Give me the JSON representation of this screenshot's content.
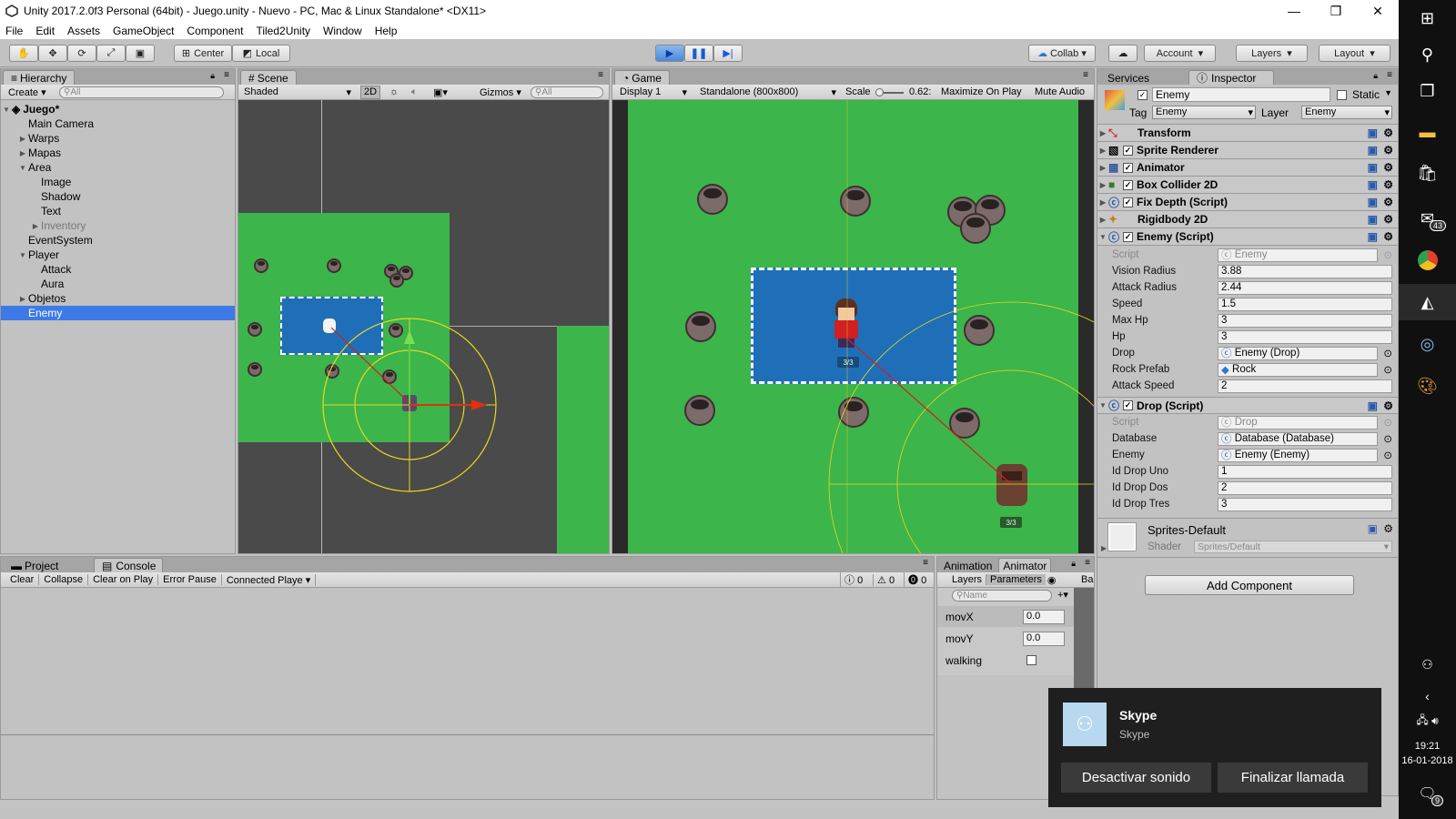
{
  "window": {
    "title": "Unity 2017.2.0f3 Personal (64bit) - Juego.unity - Nuevo - PC, Mac & Linux Standalone* <DX11>"
  },
  "menu": [
    "File",
    "Edit",
    "Assets",
    "GameObject",
    "Component",
    "Tiled2Unity",
    "Window",
    "Help"
  ],
  "toolbar": {
    "center": "Center",
    "local": "Local",
    "collab": "Collab",
    "account": "Account",
    "layers": "Layers",
    "layout": "Layout"
  },
  "hierarchy": {
    "tab": "Hierarchy",
    "create": "Create",
    "search_placeholder": "All",
    "scene": "Juego*",
    "items": [
      {
        "label": "Main Camera"
      },
      {
        "label": "Warps"
      },
      {
        "label": "Mapas"
      },
      {
        "label": "Area"
      },
      {
        "label": "Image"
      },
      {
        "label": "Shadow"
      },
      {
        "label": "Text"
      },
      {
        "label": "Inventory"
      },
      {
        "label": "EventSystem"
      },
      {
        "label": "Player"
      },
      {
        "label": "Attack"
      },
      {
        "label": "Aura"
      },
      {
        "label": "Objetos"
      },
      {
        "label": "Enemy"
      }
    ]
  },
  "scene": {
    "tab": "Scene",
    "shading": "Shaded",
    "mode_2d": "2D",
    "gizmos": "Gizmos",
    "search_placeholder": "All"
  },
  "game": {
    "tab": "Game",
    "display": "Display 1",
    "resolution": "Standalone (800x800)",
    "scale_label": "Scale",
    "scale_value": "0.62:",
    "maximize": "Maximize On Play",
    "mute": "Mute Audio",
    "hp_player": "3/3",
    "hp_enemy": "3/3"
  },
  "inspector": {
    "services_tab": "Services",
    "tab": "Inspector",
    "object_name": "Enemy",
    "static_label": "Static",
    "tag_label": "Tag",
    "tag_value": "Enemy",
    "layer_label": "Layer",
    "layer_value": "Enemy",
    "components": [
      {
        "name": "Transform"
      },
      {
        "name": "Sprite Renderer"
      },
      {
        "name": "Animator"
      },
      {
        "name": "Box Collider 2D"
      },
      {
        "name": "Fix Depth (Script)"
      },
      {
        "name": "Rigidbody 2D"
      },
      {
        "name": "Enemy (Script)"
      }
    ],
    "enemy_props": [
      {
        "label": "Script",
        "value": "Enemy"
      },
      {
        "label": "Vision Radius",
        "value": "3.88"
      },
      {
        "label": "Attack Radius",
        "value": "2.44"
      },
      {
        "label": "Speed",
        "value": "1.5"
      },
      {
        "label": "Max Hp",
        "value": "3"
      },
      {
        "label": "Hp",
        "value": "3"
      },
      {
        "label": "Drop",
        "value": "Enemy (Drop)"
      },
      {
        "label": "Rock Prefab",
        "value": "Rock"
      },
      {
        "label": "Attack Speed",
        "value": "2"
      }
    ],
    "drop_component": "Drop (Script)",
    "drop_props": [
      {
        "label": "Script",
        "value": "Drop"
      },
      {
        "label": "Database",
        "value": "Database (Database)"
      },
      {
        "label": "Enemy",
        "value": "Enemy (Enemy)"
      },
      {
        "label": "Id Drop Uno",
        "value": "1"
      },
      {
        "label": "Id Drop Dos",
        "value": "2"
      },
      {
        "label": "Id Drop Tres",
        "value": "3"
      }
    ],
    "material": "Sprites-Default",
    "shader_label": "Shader",
    "shader_value": "Sprites/Default",
    "add_component": "Add Component"
  },
  "bottom": {
    "project_tab": "Project",
    "console_tab": "Console",
    "console_buttons": [
      "Clear",
      "Collapse",
      "Clear on Play",
      "Error Pause",
      "Connected Playe"
    ],
    "counts": [
      "0",
      "0",
      "0"
    ]
  },
  "animator": {
    "tab1": "Animation",
    "tab2": "Animator",
    "layers": "Layers",
    "parameters": "Parameters",
    "ba": "Ba",
    "search_placeholder": "Name",
    "params": [
      {
        "name": "movX",
        "value": "0.0"
      },
      {
        "name": "movY",
        "value": "0.0"
      },
      {
        "name": "walking",
        "value": ""
      }
    ]
  },
  "skype": {
    "title": "Skype",
    "subtitle": "Skype",
    "btn_mute": "Desactivar sonido",
    "btn_end": "Finalizar llamada"
  },
  "tray": {
    "time": "19:21",
    "date": "16-01-2018",
    "mail_badge": "43",
    "notif_badge": "9"
  },
  "colors": {
    "selection": "#3d7ae6",
    "grass": "#3cb54a",
    "water": "#1f6fb8",
    "gizmo": "#e8d820"
  }
}
